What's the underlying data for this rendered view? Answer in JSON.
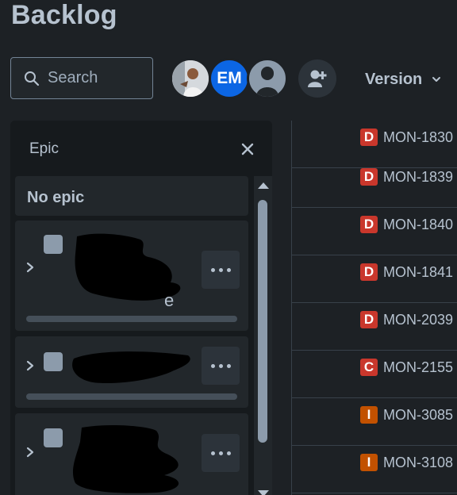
{
  "header": {
    "title": "Backlog"
  },
  "search": {
    "placeholder": "Search",
    "value": ""
  },
  "people": {
    "avatars": [
      {
        "type": "photo"
      },
      {
        "type": "initials",
        "initials": "EM",
        "color": "#0c66e4"
      },
      {
        "type": "generic"
      }
    ],
    "add_icon": "add-person-icon"
  },
  "filters": {
    "version_label": "Version"
  },
  "epic_panel": {
    "title": "Epic",
    "no_epic_label": "No epic",
    "epics": [
      {
        "name": "",
        "redacted": true,
        "progress": 0
      },
      {
        "name": "",
        "redacted": true,
        "progress": 0
      },
      {
        "name": "",
        "redacted": true,
        "progress": 0
      }
    ]
  },
  "issues": [
    {
      "key": "MON-1830",
      "type": "D",
      "color": "#c9372c"
    },
    {
      "key": "MON-1839",
      "type": "D",
      "color": "#c9372c"
    },
    {
      "key": "MON-1840",
      "type": "D",
      "color": "#c9372c"
    },
    {
      "key": "MON-1841",
      "type": "D",
      "color": "#c9372c"
    },
    {
      "key": "MON-2039",
      "type": "D",
      "color": "#c9372c"
    },
    {
      "key": "MON-2155",
      "type": "C",
      "color": "#c9372c"
    },
    {
      "key": "MON-3085",
      "type": "I",
      "color": "#c25100"
    },
    {
      "key": "MON-3108",
      "type": "I",
      "color": "#c25100"
    }
  ],
  "colors": {
    "background": "#1d2125",
    "panel": "#161a1d",
    "card": "#22272b",
    "text": "#b6c2cf"
  }
}
